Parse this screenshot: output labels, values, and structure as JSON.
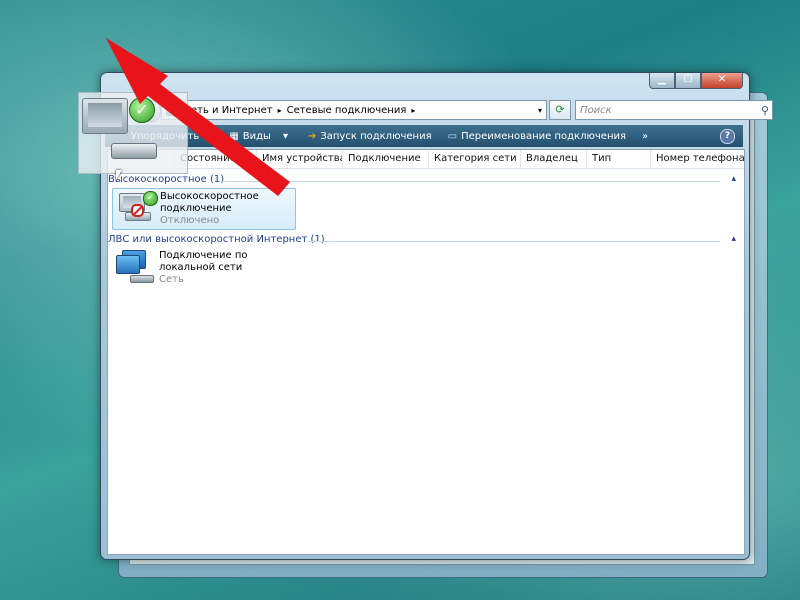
{
  "window": {
    "title_buttons": {
      "minimize": "▁",
      "maximize": "☐",
      "close": "✕"
    }
  },
  "address_bar": {
    "crumbs": [
      "Сеть и Интернет",
      "Сетевые подключения"
    ],
    "separator": "▸",
    "dropdown": "▾",
    "back_glyph": "◂",
    "refresh_glyph": "⟳"
  },
  "search": {
    "placeholder": "Поиск",
    "icon": "search-icon"
  },
  "toolbar": {
    "organize": "Упорядочить",
    "views": "Виды",
    "start_connection": "Запуск подключения",
    "rename_connection": "Переименование подключения",
    "more": "»",
    "help": "?"
  },
  "columns": [
    "Состояние",
    "Имя устройства",
    "Подключение",
    "Категория сети",
    "Владелец",
    "Тип",
    "Номер телефона..."
  ],
  "groups": [
    {
      "label": "Высокоскоростное (1)",
      "items": [
        {
          "name": "Высокоскоростное подключение",
          "status": "Отключено"
        }
      ]
    },
    {
      "label": "ЛВС или высокоскоростной Интернет (1)",
      "items": [
        {
          "name": "Подключение по локальной сети",
          "status": "Сеть"
        }
      ]
    }
  ],
  "colors": {
    "group_text": "#1f3f8f",
    "toolbar_bg": "#2f5f80",
    "arrow": "#e8141a",
    "selection_border": "#8fc3ea"
  },
  "glyphs": {
    "check": "✓",
    "caret_up": "▴",
    "toolbar_dd": "▾"
  }
}
